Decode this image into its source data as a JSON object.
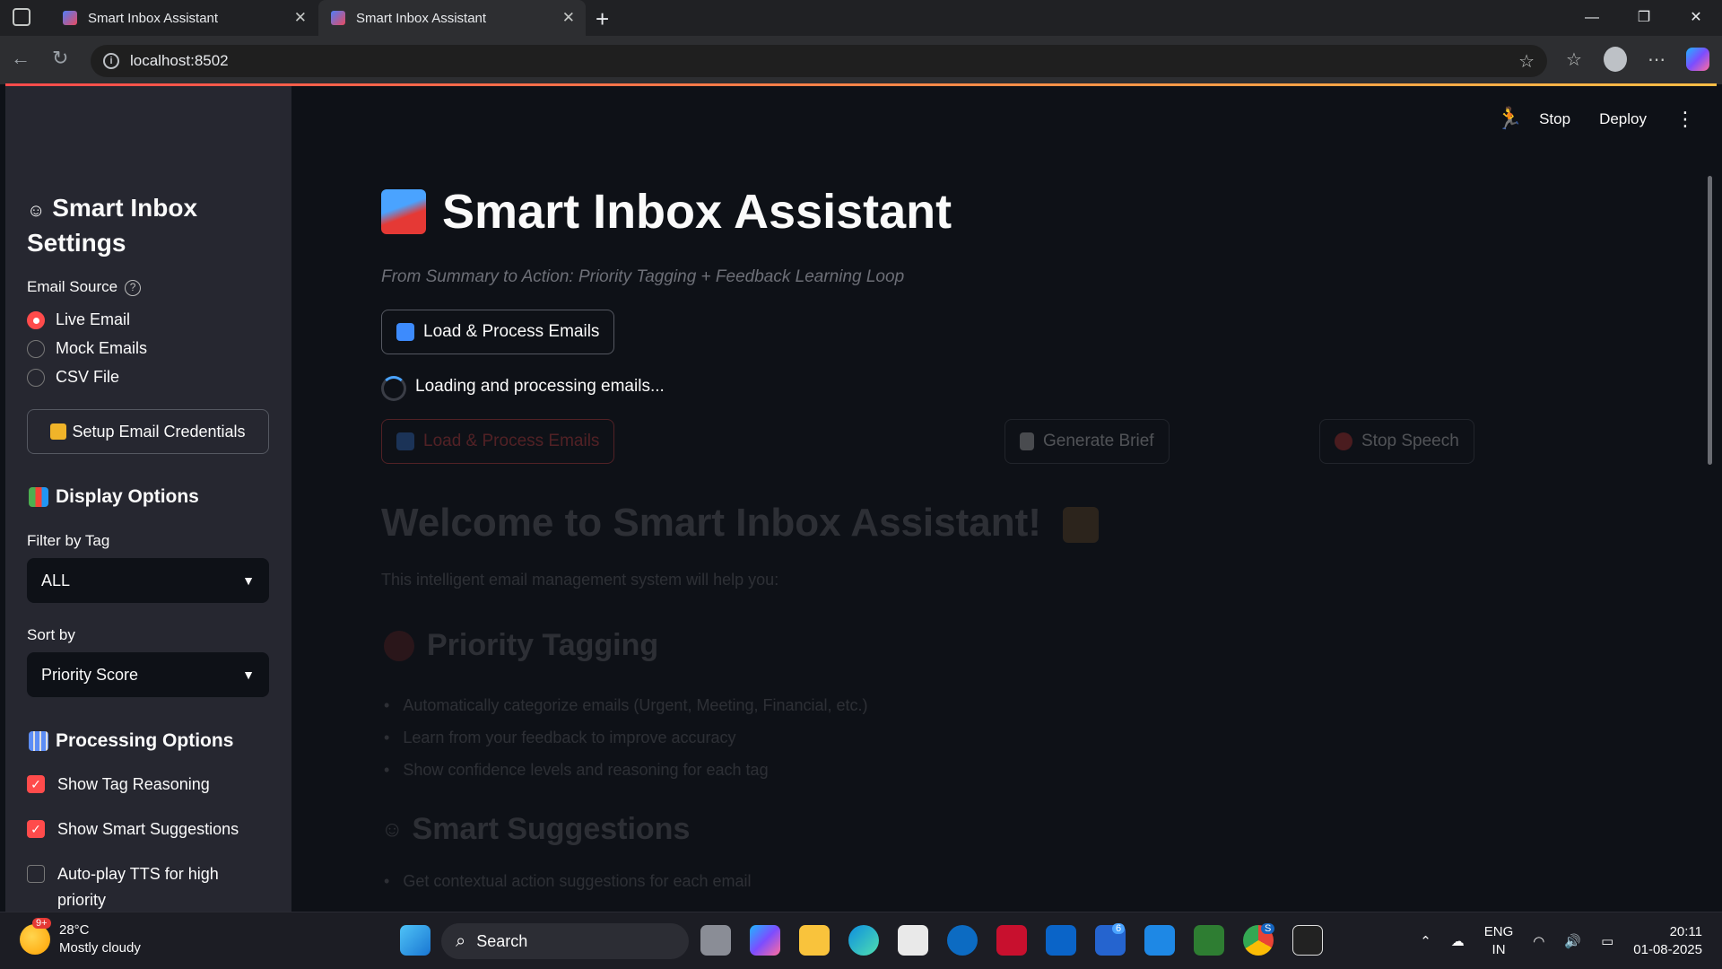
{
  "browser": {
    "tabs": [
      {
        "title": "Smart Inbox Assistant"
      },
      {
        "title": "Smart Inbox Assistant"
      }
    ],
    "url": "localhost:8502",
    "window_controls": [
      "minimize-icon",
      "restore-icon",
      "close-icon"
    ]
  },
  "sidebar": {
    "title": "Smart Inbox Settings",
    "email_source_label": "Email Source",
    "email_sources": [
      {
        "label": "Live Email",
        "selected": true
      },
      {
        "label": "Mock Emails",
        "selected": false
      },
      {
        "label": "CSV File",
        "selected": false
      }
    ],
    "setup_button": "Setup Email Credentials",
    "display_options_title": "Display Options",
    "filter_label": "Filter by Tag",
    "filter_value": "ALL",
    "sort_label": "Sort by",
    "sort_value": "Priority Score",
    "processing_title": "Processing Options",
    "checkboxes": [
      {
        "label": "Show Tag Reasoning",
        "checked": true
      },
      {
        "label": "Show Smart Suggestions",
        "checked": true
      },
      {
        "label": "Auto-play TTS for high priority",
        "checked": false
      }
    ]
  },
  "header": {
    "stop_label": "Stop",
    "deploy_label": "Deploy"
  },
  "main": {
    "title": "Smart Inbox Assistant",
    "subtitle": "From Summary to Action: Priority Tagging + Feedback Learning Loop",
    "load_button": "Load & Process Emails",
    "loading_text": "Loading and processing emails...",
    "stale_buttons": {
      "load": "Load & Process Emails",
      "brief": "Generate Brief",
      "stop_speech": "Stop Speech"
    },
    "welcome_title": "Welcome to Smart Inbox Assistant!",
    "welcome_text": "This intelligent email management system will help you:",
    "priority_title": "Priority Tagging",
    "priority_items": [
      "Automatically categorize emails (Urgent, Meeting, Financial, etc.)",
      "Learn from your feedback to improve accuracy",
      "Show confidence levels and reasoning for each tag"
    ],
    "suggestions_title": "Smart Suggestions",
    "suggestions_items": [
      "Get contextual action suggestions for each email"
    ]
  },
  "taskbar": {
    "weather_temp": "28°C",
    "weather_desc": "Mostly cloudy",
    "weather_badge": "9+",
    "search_placeholder": "Search",
    "lang_line1": "ENG",
    "lang_line2": "IN",
    "time": "20:11",
    "date": "01-08-2025",
    "badges": {
      "todo": "6",
      "chrome": "S"
    }
  },
  "colors": {
    "accent": "#ff4b4b",
    "sidebar_bg": "#262730",
    "main_bg": "#0e1117"
  }
}
